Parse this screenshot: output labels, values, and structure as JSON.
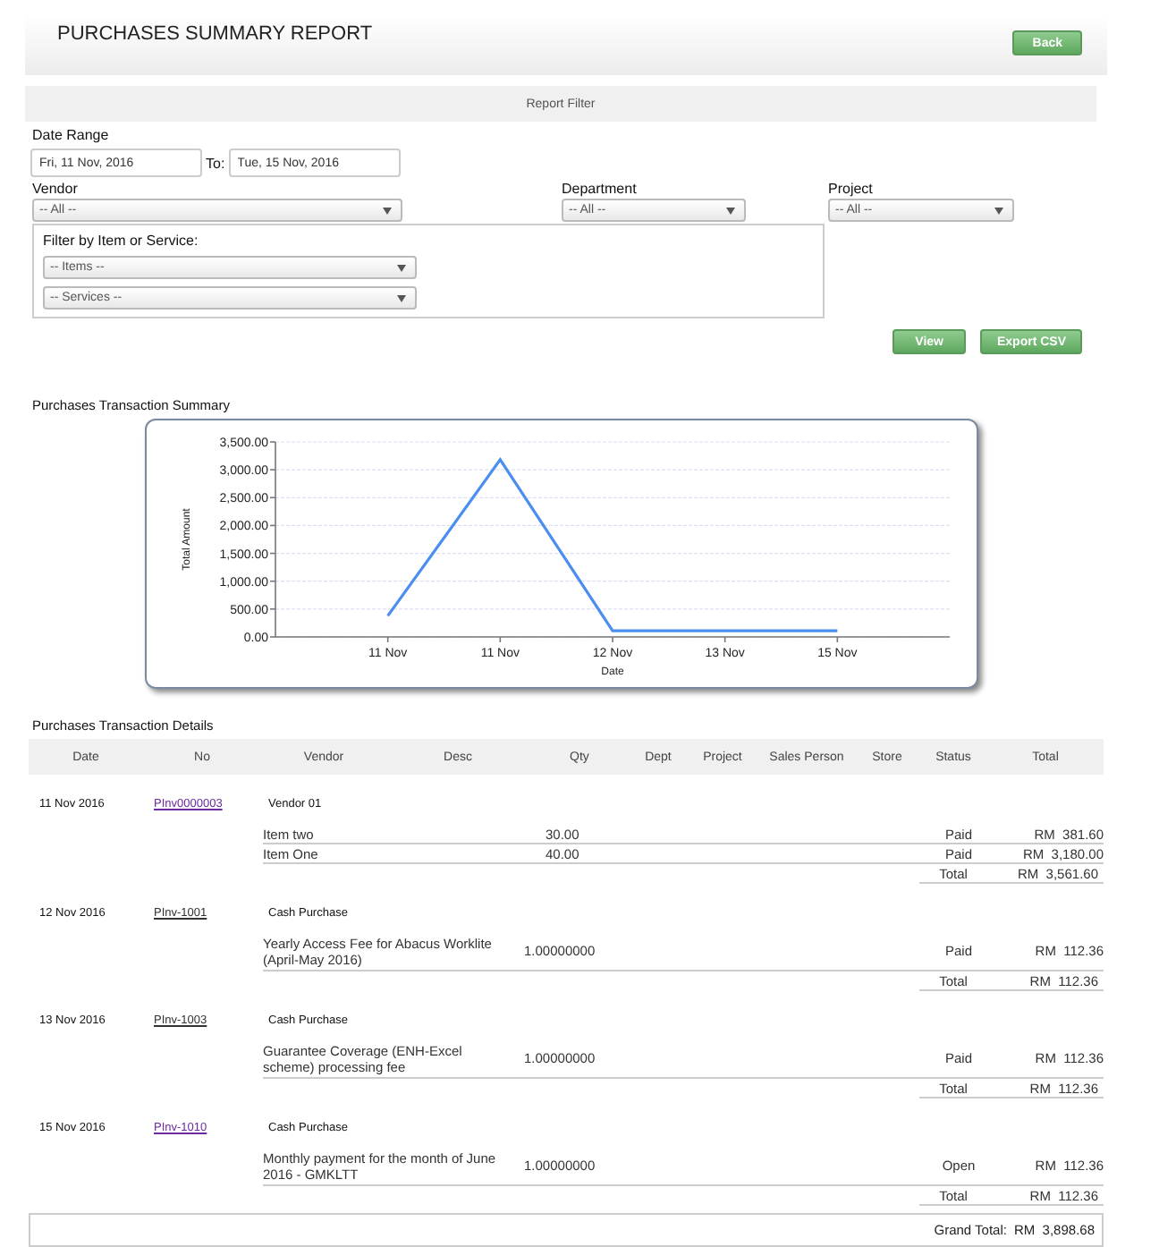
{
  "header": {
    "title": "PURCHASES SUMMARY REPORT",
    "back_button": "Back"
  },
  "filter": {
    "title": "Report Filter",
    "date_range_label": "Date Range",
    "date_from": "Fri, 11 Nov, 2016",
    "to_label": "To:",
    "date_to": "Tue, 15 Nov, 2016",
    "selects": [
      {
        "label": "Vendor",
        "value": "-- All --"
      },
      {
        "label": "Department",
        "value": "-- All --"
      },
      {
        "label": "Project",
        "value": "-- All --"
      }
    ],
    "item_filter": {
      "label": "Filter by Item or Service:",
      "selects": [
        "-- Items --",
        "-- Services --"
      ]
    },
    "buttons": [
      "View",
      "Export CSV"
    ]
  },
  "summary": {
    "title": "Purchases Transaction Summary",
    "chart_data": {
      "type": "line",
      "xlabel": "Date",
      "ylabel": "Total Amount",
      "categories": [
        "11 Nov",
        "11 Nov",
        "12 Nov",
        "13 Nov",
        "15 Nov"
      ],
      "values": [
        380,
        3180,
        110,
        110,
        110
      ],
      "grid": true,
      "ylim": [
        0,
        3500
      ],
      "yticks": [
        {
          "value": 0,
          "label": "0.00"
        },
        {
          "value": 500,
          "label": "500.00"
        },
        {
          "value": 1000,
          "label": "1,000.00"
        },
        {
          "value": 1500,
          "label": "1,500.00"
        },
        {
          "value": 2000,
          "label": "2,000.00"
        },
        {
          "value": 2500,
          "label": "2,500.00"
        },
        {
          "value": 3000,
          "label": "3,000.00"
        },
        {
          "value": 3500,
          "label": "3,500.00"
        }
      ]
    }
  },
  "details": {
    "title": "Purchases Transaction Details",
    "columns": [
      "Date",
      "No",
      "Vendor",
      "Desc",
      "Qty",
      "Dept",
      "Project",
      "Sales Person",
      "Store",
      "Status",
      "Total"
    ],
    "groups": [
      {
        "date": "11 Nov 2016",
        "no": "PInv0000003",
        "visited": true,
        "vendor": "Vendor 01",
        "items": [
          {
            "desc": "Item two",
            "qty": "30.00",
            "status": "Paid",
            "total": "RM  381.60"
          },
          {
            "desc": "Item One",
            "qty": "40.00",
            "status": "Paid",
            "total": "RM  3,180.00"
          }
        ],
        "total_label": "Total",
        "total": "RM  3,561.60"
      },
      {
        "date": "12 Nov 2016",
        "no": "PInv-1001",
        "visited": false,
        "vendor": "Cash Purchase",
        "items": [
          {
            "desc": "Yearly Access Fee for Abacus Worklite (April-May 2016)",
            "qty": "1.00000000",
            "status": "Paid",
            "total": "RM  112.36"
          }
        ],
        "total_label": "Total",
        "total": "RM  112.36"
      },
      {
        "date": "13 Nov 2016",
        "no": "PInv-1003",
        "visited": false,
        "vendor": "Cash Purchase",
        "items": [
          {
            "desc": "Guarantee Coverage (ENH-Excel scheme) processing fee",
            "qty": "1.00000000",
            "status": "Paid",
            "total": "RM  112.36"
          }
        ],
        "total_label": "Total",
        "total": "RM  112.36"
      },
      {
        "date": "15 Nov 2016",
        "no": "PInv-1010",
        "visited": true,
        "vendor": "Cash Purchase",
        "items": [
          {
            "desc": "Monthly payment for the month of June 2016 - GMKLTT",
            "qty": "1.00000000",
            "status": "Open",
            "total": "RM  112.36"
          }
        ],
        "total_label": "Total",
        "total": "RM  112.36"
      }
    ],
    "grand_total_label": "Grand Total:",
    "grand_total": "RM  3,898.68"
  }
}
